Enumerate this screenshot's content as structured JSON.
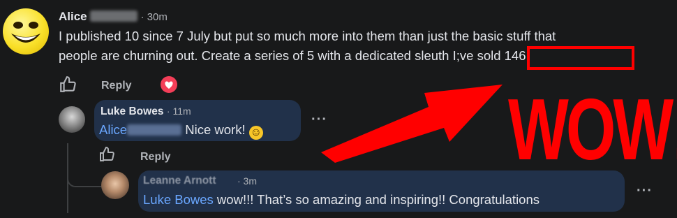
{
  "post": {
    "author": "Alice",
    "time": "· 30m",
    "line1": "I published 10 since 7 July but put so much more into them than just the basic stuff that",
    "line2_pre": "people are churning out. Create a series of 5 with a dedicated sleuth ",
    "line2_highlight": "I;ve sold 146",
    "reply_label": "Reply"
  },
  "reply1": {
    "author": "Luke Bowes",
    "time": "· 11m",
    "mention": "Alice",
    "text": " Nice work! ",
    "emoji": "☺",
    "more": "···",
    "reply_label": "Reply"
  },
  "reply2": {
    "author": "Leanne Arnott",
    "time": "· 3m",
    "mention": "Luke Bowes",
    "text": " wow!!! That’s so amazing and inspiring!! Congratulations",
    "more": "···"
  },
  "annotation": {
    "text": "WOW!",
    "color": "#ff0000"
  },
  "colors": {
    "background": "#18191a",
    "bubble": "#21314a",
    "mention": "#6aa7ff",
    "love": "#f33e58"
  }
}
